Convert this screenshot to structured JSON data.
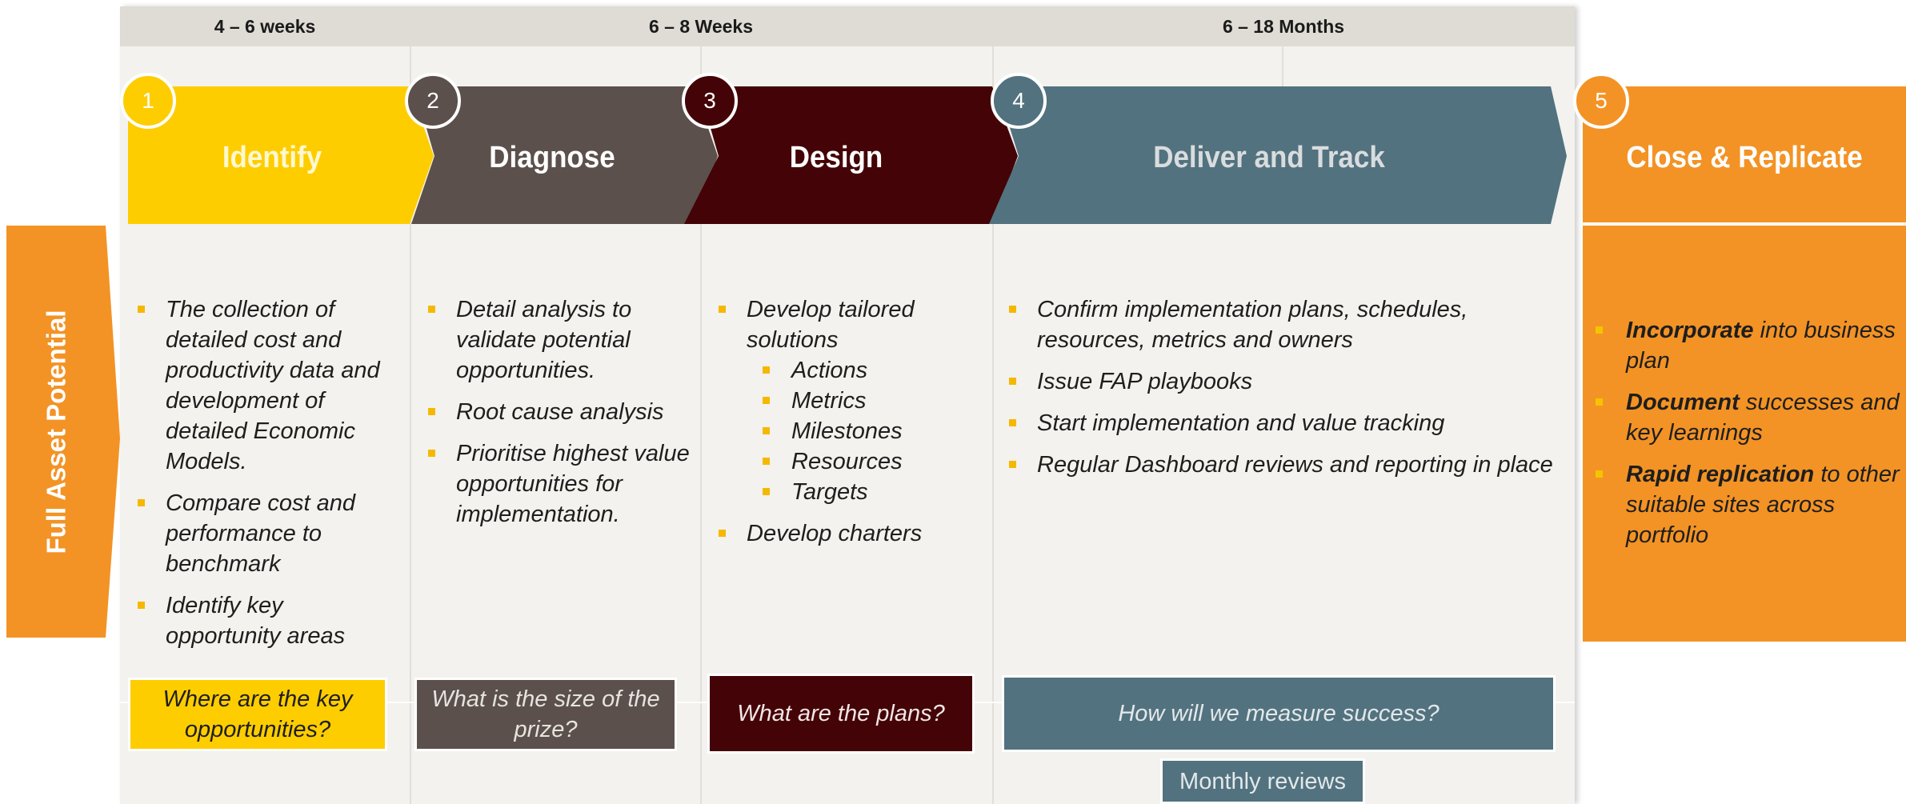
{
  "durations": [
    "4 – 6 weeks",
    "6 – 8 Weeks",
    "6 – 18 Months"
  ],
  "side_label": "Full Asset Potential",
  "colors": {
    "identify": "#fecd00",
    "diagnose": "#5b504c",
    "design": "#440306",
    "deliver": "#52727f",
    "close": "#f39325",
    "bullet": "#f5b800",
    "panel": "#f3f2ee",
    "header_band": "#dfdbd5"
  },
  "phases": [
    {
      "number": "1",
      "title": "Identify",
      "bullets": [
        "The collection of detailed cost and productivity data and development of detailed Economic Models.",
        "Compare cost and performance to benchmark",
        "Identify key opportunity areas"
      ],
      "question": "Where are the key opportunities?"
    },
    {
      "number": "2",
      "title": "Diagnose",
      "bullets": [
        "Detail analysis to validate potential opportunities.",
        "Root cause analysis",
        "Prioritise highest value opportunities for implementation."
      ],
      "question": "What is the size of the prize?"
    },
    {
      "number": "3",
      "title": "Design",
      "bullets": [
        "Develop tailored solutions",
        "Develop charters"
      ],
      "sub_bullets": [
        "Actions",
        "Metrics",
        "Milestones",
        "Resources",
        "Targets"
      ],
      "question": "What are the plans?"
    },
    {
      "number": "4",
      "title": "Deliver and Track",
      "bullets": [
        "Confirm implementation plans, schedules, resources, metrics and owners",
        "Issue FAP playbooks",
        "Start implementation and value tracking",
        "Regular Dashboard reviews and reporting in place"
      ],
      "question": "How will we measure success?",
      "note": "Monthly reviews"
    },
    {
      "number": "5",
      "title": "Close & Replicate",
      "items": [
        {
          "bold": "Incorporate",
          "rest": " into business plan"
        },
        {
          "bold": "Document",
          "rest": " successes and key learnings"
        },
        {
          "bold": "Rapid replication",
          "rest": " to other suitable sites across portfolio"
        }
      ]
    }
  ]
}
